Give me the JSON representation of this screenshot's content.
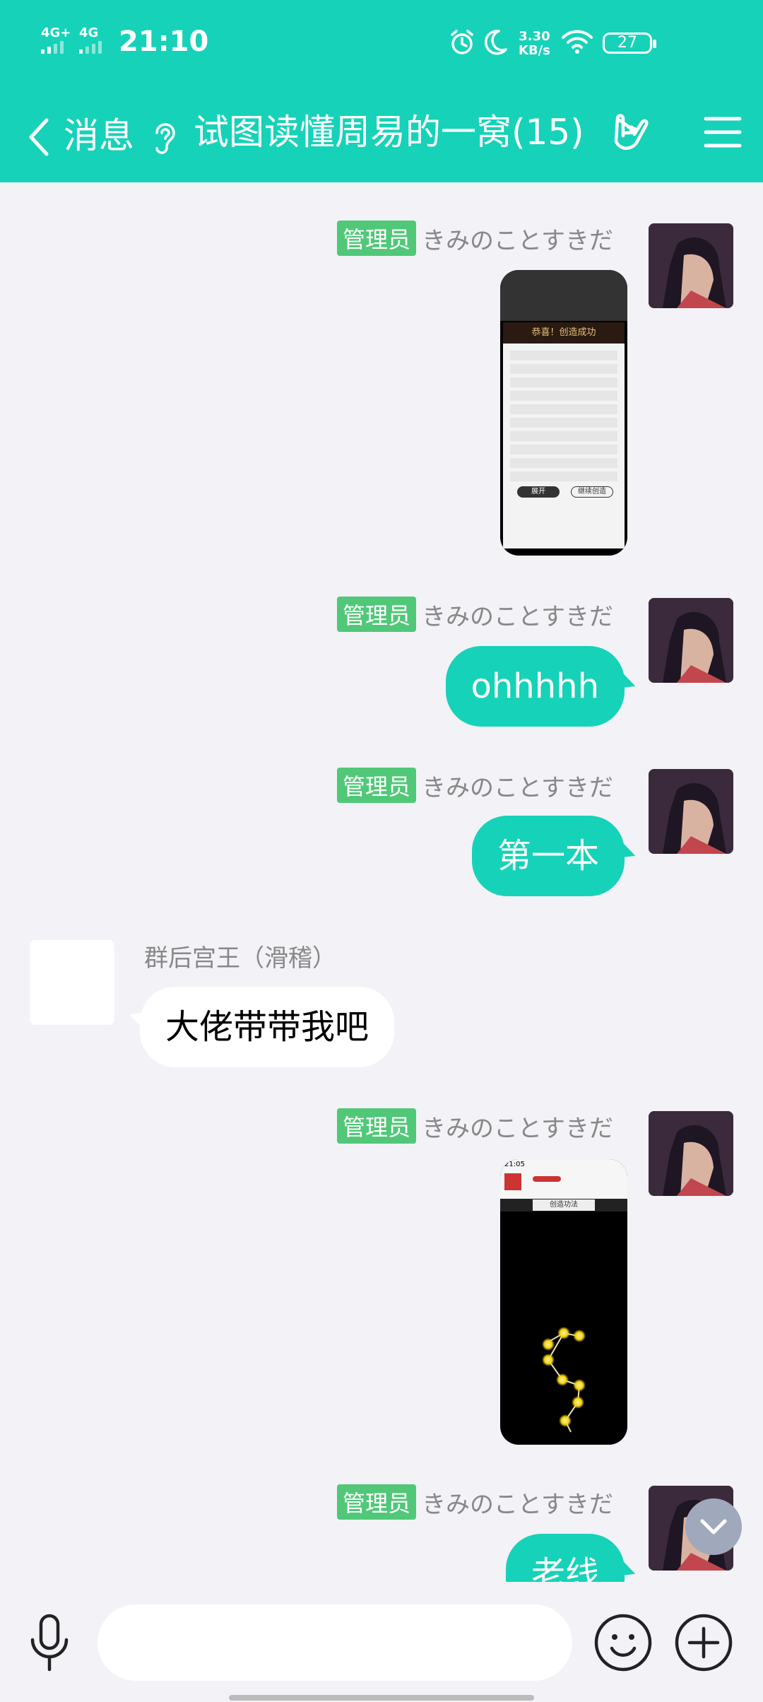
{
  "status_bar": {
    "time": "21:10",
    "signal1": "4G+",
    "signal2": "4G",
    "net_speed_value": "3.30",
    "net_speed_unit": "KB/s",
    "battery": "27"
  },
  "header": {
    "back_label": "消息",
    "title": "试图读懂周易的一窝(15)"
  },
  "messages": [
    {
      "type": "image",
      "sender": "きみのことすきだ",
      "badge": "管理员",
      "img_title": "恭喜！创造成功",
      "img_left_btn": "展开",
      "img_right_btn": "继续创造"
    },
    {
      "type": "text",
      "sender": "きみのことすきだ",
      "badge": "管理员",
      "text": "ohhhhh"
    },
    {
      "type": "text",
      "sender": "きみのことすきだ",
      "badge": "管理员",
      "text": "第一本"
    },
    {
      "type": "text",
      "sender": "群后宫王（滑稽）",
      "badge": "",
      "text": "大佬带带我吧"
    },
    {
      "type": "image",
      "sender": "きみのことすきだ",
      "badge": "管理员",
      "img_time": "21:05",
      "img_tab": "创造功法"
    },
    {
      "type": "text",
      "sender": "きみのことすきだ",
      "badge": "管理员",
      "text": "老线"
    }
  ],
  "input": {
    "placeholder": ""
  },
  "colors": {
    "accent": "#16d2b8",
    "badge": "#50c878",
    "background": "#f2f2f7"
  },
  "icons": [
    "microphone-icon",
    "emoji-icon",
    "plus-icon",
    "menu-icon",
    "hand-icon",
    "ear-icon",
    "chevron-down-icon",
    "back-chevron-icon"
  ]
}
